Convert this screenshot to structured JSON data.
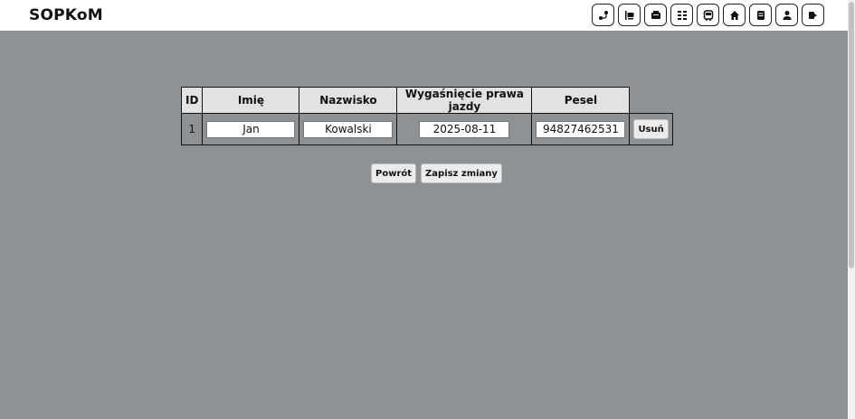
{
  "app": {
    "title": "SOPKoM"
  },
  "nav": {
    "buttons": [
      {
        "icon": "route-icon"
      },
      {
        "icon": "bus-stop-icon"
      },
      {
        "icon": "ticket-icon"
      },
      {
        "icon": "timetable-icon"
      },
      {
        "icon": "bus-icon"
      },
      {
        "icon": "home-icon"
      },
      {
        "icon": "document-icon"
      },
      {
        "icon": "user-icon"
      },
      {
        "icon": "logout-icon"
      }
    ]
  },
  "table": {
    "headers": [
      "ID",
      "Imię",
      "Nazwisko",
      "Wygaśnięcie prawa jazdy",
      "Pesel"
    ],
    "rows": [
      {
        "id": "1",
        "imie": "Jan",
        "nazwisko": "Kowalski",
        "wygasniecie": "2025-08-11",
        "pesel": "94827462531",
        "delete_label": "Usuń"
      }
    ]
  },
  "actions": {
    "back_label": "Powrót",
    "save_label": "Zapisz zmiany"
  }
}
